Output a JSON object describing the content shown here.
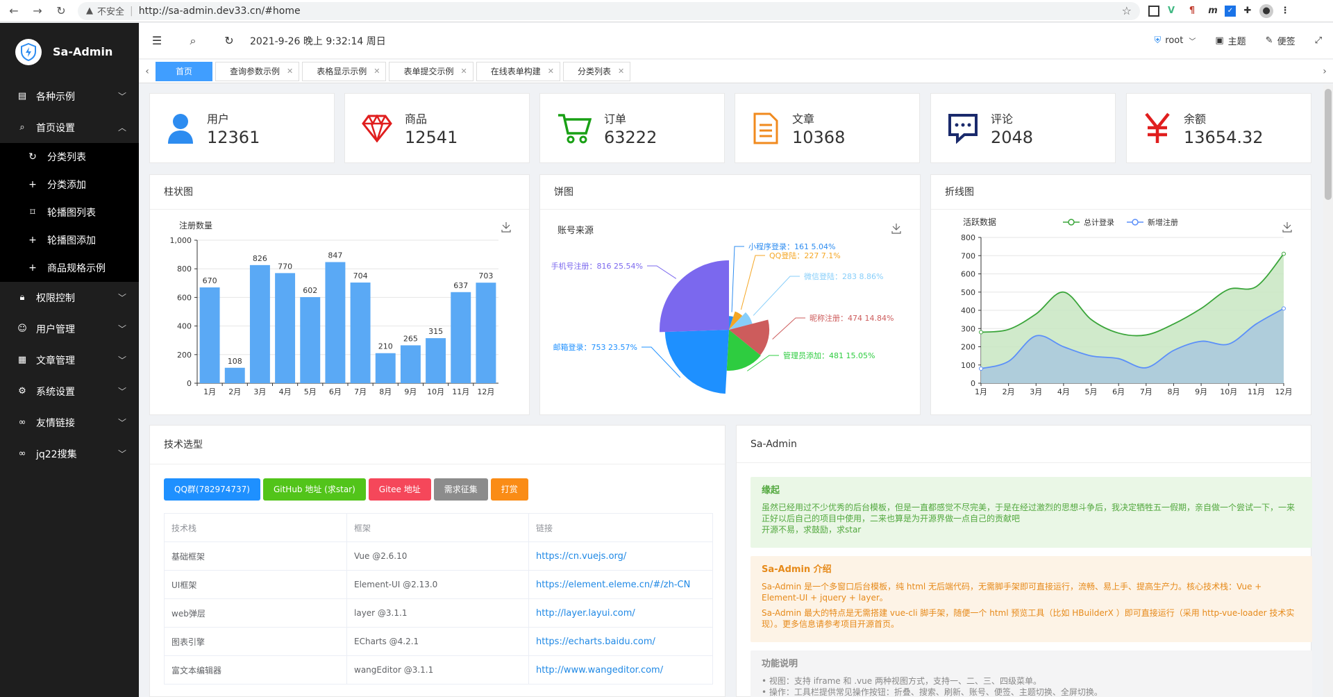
{
  "browser": {
    "warn": "不安全",
    "url": "http://sa-admin.dev33.cn/#home"
  },
  "brand": {
    "title": "Sa-Admin"
  },
  "sidebar": {
    "items": [
      {
        "label": "各种示例",
        "icon": "file-icon",
        "expanded": false
      },
      {
        "label": "首页设置",
        "icon": "search-icon",
        "expanded": true
      }
    ],
    "sub": [
      {
        "label": "分类列表",
        "icon": "refresh-icon"
      },
      {
        "label": "分类添加",
        "icon": "plus-icon"
      },
      {
        "label": "轮播图列表",
        "icon": "bookmark-icon"
      },
      {
        "label": "轮播图添加",
        "icon": "plus-icon"
      },
      {
        "label": "商品规格示例",
        "icon": "plus-icon"
      }
    ],
    "items2": [
      {
        "label": "权限控制",
        "icon": "lock-icon"
      },
      {
        "label": "用户管理",
        "icon": "user-icon"
      },
      {
        "label": "文章管理",
        "icon": "doc-icon"
      },
      {
        "label": "系统设置",
        "icon": "gear-icon"
      },
      {
        "label": "友情链接",
        "icon": "link-icon"
      },
      {
        "label": "jq22搜集",
        "icon": "link-icon"
      }
    ]
  },
  "topbar": {
    "datetime": "2021-9-26 晚上 9:32:14 周日",
    "user": "root",
    "theme": "主题",
    "notes": "便签"
  },
  "tabs": [
    {
      "label": "首页",
      "active": true
    },
    {
      "label": "查询参数示例"
    },
    {
      "label": "表格显示示例"
    },
    {
      "label": "表单提交示例"
    },
    {
      "label": "在线表单构建"
    },
    {
      "label": "分类列表"
    }
  ],
  "stats": [
    {
      "label": "用户",
      "value": "12361",
      "color": "#2d8cf0",
      "icon": "user-icon"
    },
    {
      "label": "商品",
      "value": "12541",
      "color": "#e01e1e",
      "icon": "diamond-icon"
    },
    {
      "label": "订单",
      "value": "63222",
      "color": "#19a015",
      "icon": "cart-icon"
    },
    {
      "label": "文章",
      "value": "10368",
      "color": "#f08a1e",
      "icon": "document-icon"
    },
    {
      "label": "评论",
      "value": "2048",
      "color": "#1a2a6c",
      "icon": "comment-icon"
    },
    {
      "label": "余额",
      "value": "13654.32",
      "color": "#e01e1e",
      "icon": "yen-icon"
    }
  ],
  "panels": {
    "bar": "柱状图",
    "pie": "饼图",
    "line": "折线图",
    "tech": "技术选型",
    "about": "Sa-Admin"
  },
  "chart_data": [
    {
      "type": "bar",
      "title": "注册数量",
      "categories": [
        "1月",
        "2月",
        "3月",
        "4月",
        "5月",
        "6月",
        "7月",
        "8月",
        "9月",
        "10月",
        "11月",
        "12月"
      ],
      "values": [
        670,
        108,
        826,
        770,
        602,
        847,
        704,
        210,
        265,
        315,
        637,
        703
      ],
      "ylim": [
        0,
        1000
      ],
      "yticks": [
        "0",
        "200",
        "400",
        "600",
        "800",
        "1,000"
      ],
      "color": "#5aa9f5"
    },
    {
      "type": "pie",
      "title": "账号来源",
      "series": [
        {
          "name": "小程序登录",
          "value": 161,
          "pct": "5.04%",
          "color": "#2d8cf0"
        },
        {
          "name": "QQ登陆",
          "value": 227,
          "pct": "7.1%",
          "color": "#f5a623"
        },
        {
          "name": "微信登陆",
          "value": 283,
          "pct": "8.86%",
          "color": "#87cefa"
        },
        {
          "name": "昵称注册",
          "value": 474,
          "pct": "14.84%",
          "color": "#cd5c5c"
        },
        {
          "name": "管理员添加",
          "value": 481,
          "pct": "15.05%",
          "color": "#2ecc40"
        },
        {
          "name": "邮箱登录",
          "value": 753,
          "pct": "23.57%",
          "color": "#1e90ff"
        },
        {
          "name": "手机号注册",
          "value": 816,
          "pct": "25.54%",
          "color": "#7b68ee"
        }
      ]
    },
    {
      "type": "area",
      "title": "活跃数据",
      "categories": [
        "1月",
        "2月",
        "3月",
        "4月",
        "5月",
        "6月",
        "7月",
        "8月",
        "9月",
        "10月",
        "11月",
        "12月"
      ],
      "ylim": [
        0,
        800
      ],
      "yticks": [
        "0",
        "100",
        "200",
        "300",
        "400",
        "500",
        "600",
        "700",
        "800"
      ],
      "series": [
        {
          "name": "总计登录",
          "values": [
            280,
            295,
            380,
            500,
            350,
            275,
            265,
            325,
            410,
            515,
            530,
            710
          ],
          "color": "#3aa53a",
          "fill": "#c8e6c2"
        },
        {
          "name": "新增注册",
          "values": [
            80,
            120,
            260,
            200,
            150,
            135,
            85,
            180,
            230,
            215,
            325,
            410
          ],
          "color": "#5b8ff9",
          "fill": "#a9c8de"
        }
      ]
    }
  ],
  "tech": {
    "buttons": [
      {
        "label": "QQ群(782974737)",
        "color": "#1e90ff"
      },
      {
        "label": "GitHub 地址 (求star)",
        "color": "#52c41a"
      },
      {
        "label": "Gitee 地址",
        "color": "#f5475a"
      },
      {
        "label": "需求征集",
        "color": "#8c8c8c"
      },
      {
        "label": "打赏",
        "color": "#fa8c16"
      }
    ],
    "headers": [
      "技术栈",
      "框架",
      "链接"
    ],
    "rows": [
      [
        "基础框架",
        "Vue @2.6.10",
        "https://cn.vuejs.org/"
      ],
      [
        "UI框架",
        "Element-UI @2.13.0",
        "https://element.eleme.cn/#/zh-CN"
      ],
      [
        "web弹层",
        "layer @3.1.1",
        "http://layer.layui.com/"
      ],
      [
        "图表引擎",
        "ECharts @4.2.1",
        "https://echarts.baidu.com/"
      ],
      [
        "富文本编辑器",
        "wangEditor @3.1.1",
        "http://www.wangeditor.com/"
      ]
    ]
  },
  "about": {
    "s1_title": "缘起",
    "s1_p1": "虽然已经用过不少优秀的后台模板，但是一直都感觉不尽完美，于是在经过激烈的思想斗争后，我决定牺牲五一假期，亲自做一个尝试一下，一来正好以后自己的项目中使用，二来也算是为开源界做一点自己的贡献吧",
    "s1_p2": "开源不易，求鼓励，求star",
    "s2_title": "Sa-Admin 介绍",
    "s2_p1": "Sa-Admin 是一个多窗口后台模板，纯 html 无后端代码，无需脚手架即可直接运行，流畅、易上手、提高生产力。核心技术栈：Vue + Element-UI + jquery + layer。",
    "s2_p2": "Sa-Admin 最大的特点是无需搭建 vue-cli 脚手架，随便一个 html 预览工具（比如 HBuilderX ）即可直接运行（采用 http-vue-loader 技术实现）。更多信息请参考项目开源首页。",
    "s3_title": "功能说明",
    "s3_li1": "视图：支持 iframe 和 .vue 两种视图方式，支持一、二、三、四级菜单。",
    "s3_li2": "操作：工具栏提供常见操作按钮：折叠、搜索、刷新、账号、便签、主题切换、全屏切换。"
  }
}
